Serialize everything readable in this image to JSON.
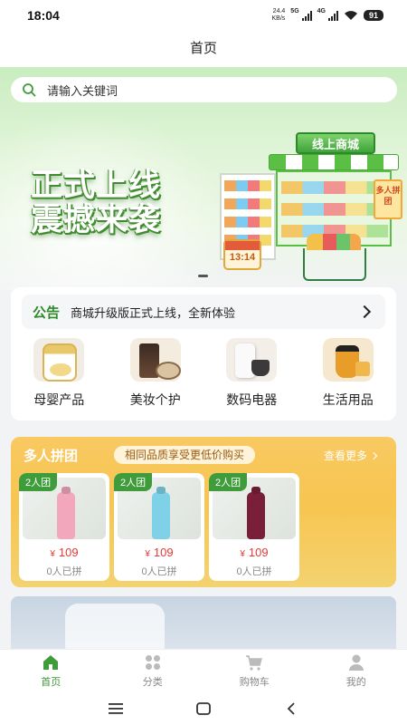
{
  "status_bar": {
    "time": "18:04",
    "net_speed_value": "24.4",
    "net_speed_unit": "KB/s",
    "signal_1": "5G",
    "signal_2": "4G",
    "battery": "91"
  },
  "nav": {
    "title": "首页"
  },
  "search": {
    "placeholder": "请输入关键词",
    "icon": "search-icon"
  },
  "banner": {
    "headline_line1": "正式上线",
    "headline_line2": "震撼来袭",
    "shop_sign": "线上商城",
    "clock": "13:14",
    "corner_badge": "多人拼团",
    "colors": {
      "green": "#3f8d2c",
      "light": "#dff4d6"
    }
  },
  "notice": {
    "tag": "公告",
    "text": "商城升级版正式上线，全新体验"
  },
  "categories": [
    {
      "label": "母婴产品",
      "icon": "baby-formula-image"
    },
    {
      "label": "美妆个护",
      "icon": "beauty-product-image"
    },
    {
      "label": "数码电器",
      "icon": "digital-appliance-image"
    },
    {
      "label": "生活用品",
      "icon": "daily-goods-image"
    }
  ],
  "group_buy": {
    "title": "多人拼团",
    "slogan": "相同品质享受更低价购买",
    "more": "查看更多",
    "items": [
      {
        "tag": "2人团",
        "currency": "¥",
        "price": "109",
        "sold": "0人已拼",
        "color": "#f2a7bd"
      },
      {
        "tag": "2人团",
        "currency": "¥",
        "price": "109",
        "sold": "0人已拼",
        "color": "#7fd1e8"
      },
      {
        "tag": "2人团",
        "currency": "¥",
        "price": "109",
        "sold": "0人已拼",
        "color": "#7a1f3a"
      }
    ]
  },
  "tabbar": {
    "items": [
      {
        "label": "首页",
        "icon": "home-icon",
        "active": true
      },
      {
        "label": "分类",
        "icon": "category-icon",
        "active": false
      },
      {
        "label": "购物车",
        "icon": "cart-icon",
        "active": false
      },
      {
        "label": "我的",
        "icon": "user-icon",
        "active": false
      }
    ],
    "active_color": "#3f9c3a"
  },
  "system_nav": [
    "menu-icon",
    "home-square-icon",
    "back-icon"
  ]
}
